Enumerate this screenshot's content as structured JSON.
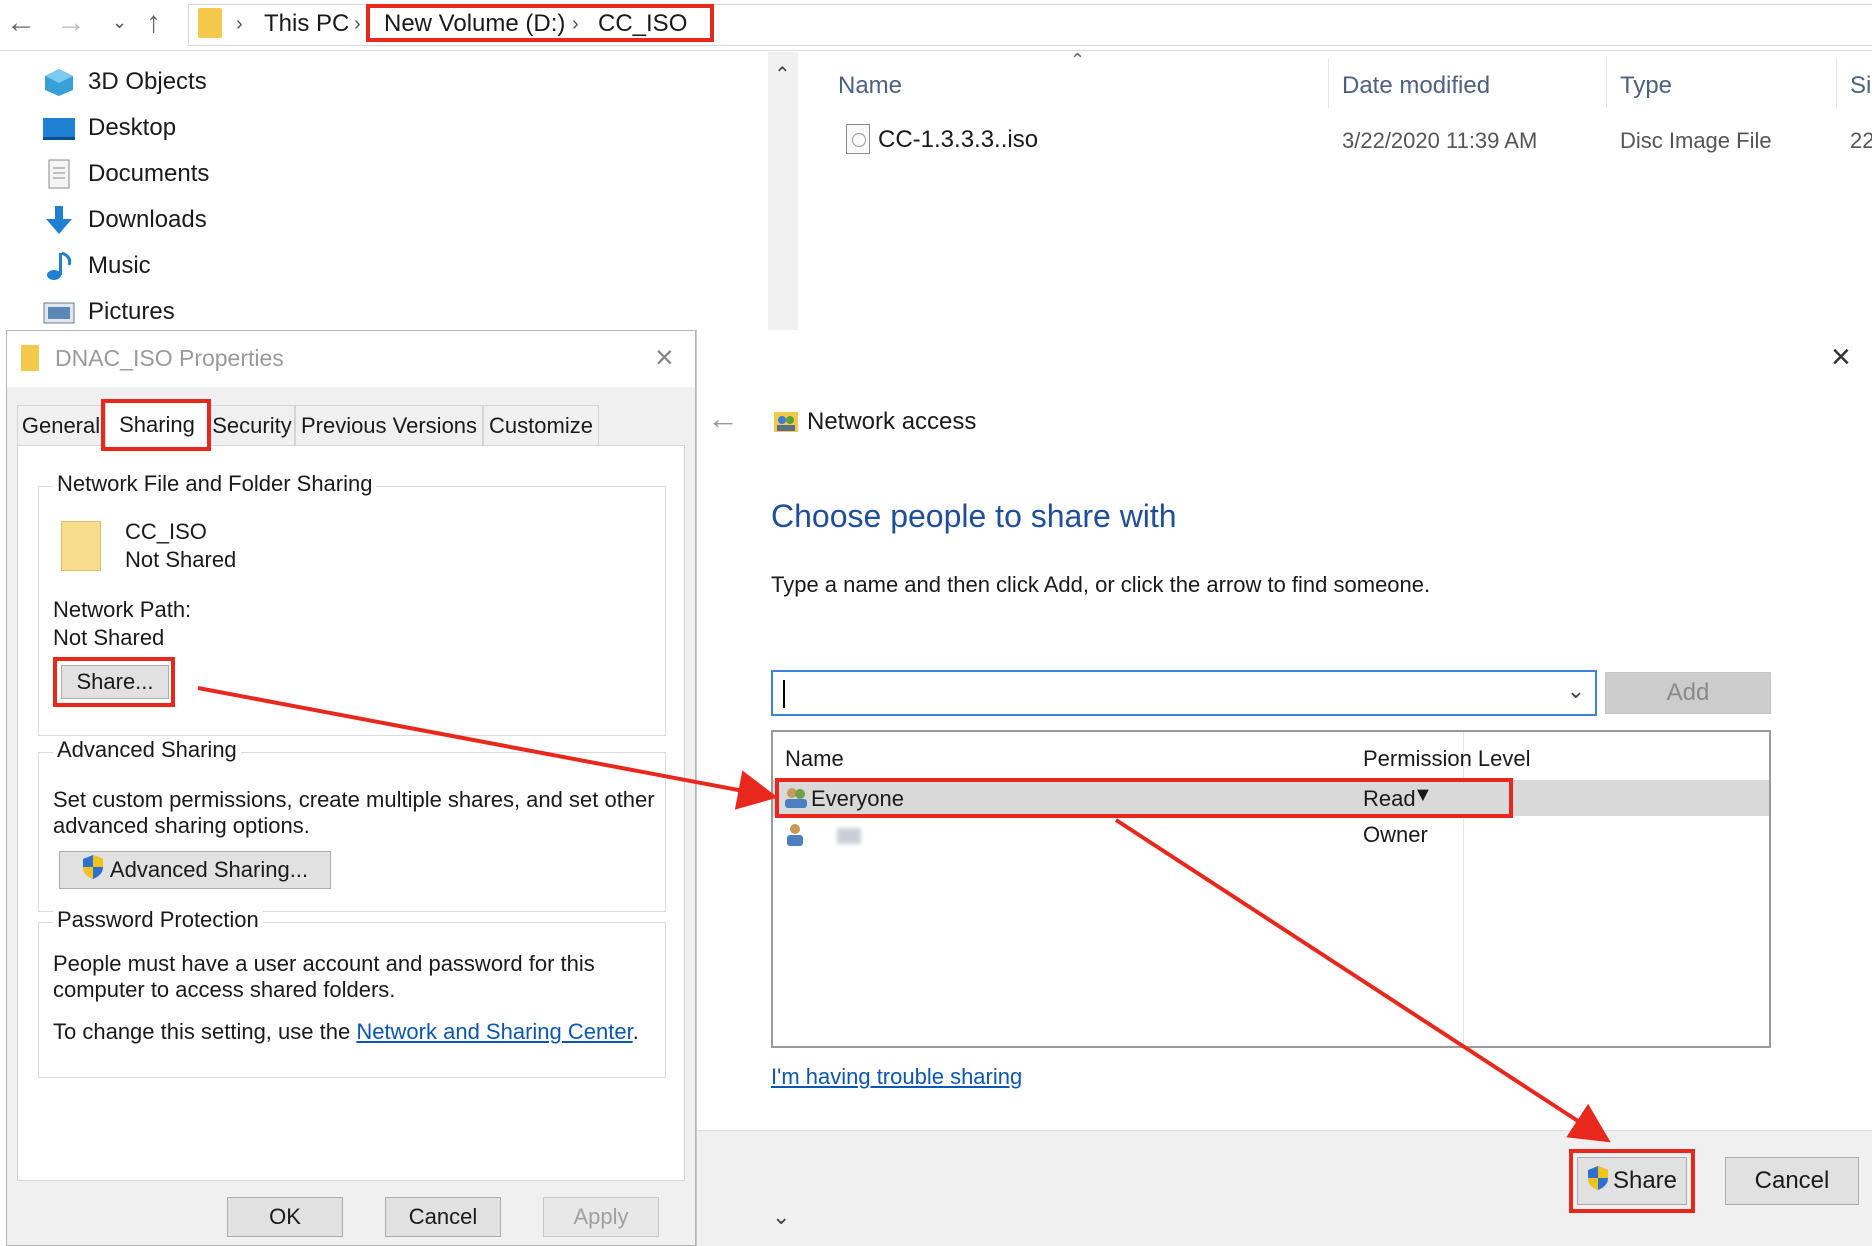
{
  "explorer": {
    "breadcrumb": [
      "This PC",
      "New Volume (D:)",
      "CC_ISO"
    ],
    "nav_items": [
      {
        "label": "3D Objects",
        "icon": "3d-objects-icon"
      },
      {
        "label": "Desktop",
        "icon": "desktop-icon"
      },
      {
        "label": "Documents",
        "icon": "documents-icon"
      },
      {
        "label": "Downloads",
        "icon": "downloads-icon"
      },
      {
        "label": "Music",
        "icon": "music-icon"
      },
      {
        "label": "Pictures",
        "icon": "pictures-icon"
      }
    ],
    "columns": {
      "name": "Name",
      "date": "Date modified",
      "type": "Type",
      "size": "Si"
    },
    "files": [
      {
        "name": "CC-1.3.3.3..iso",
        "date": "3/22/2020 11:39 AM",
        "type": "Disc Image File",
        "size": "22"
      }
    ]
  },
  "properties": {
    "title": "DNAC_ISO Properties",
    "tabs": [
      "General",
      "Sharing",
      "Security",
      "Previous Versions",
      "Customize"
    ],
    "active_tab": "Sharing",
    "network_sharing": {
      "group_label": "Network File and Folder Sharing",
      "folder_name": "CC_ISO",
      "folder_status": "Not Shared",
      "path_label": "Network Path:",
      "path_value": "Not Shared",
      "share_button": "Share..."
    },
    "advanced": {
      "group_label": "Advanced Sharing",
      "line1": "Set custom permissions, create multiple shares, and set other",
      "line2": "advanced sharing options.",
      "button": "Advanced Sharing..."
    },
    "password": {
      "group_label": "Password Protection",
      "line1": "People must have a user account and password for this",
      "line2": "computer to access shared folders.",
      "change_prefix": "To change this setting, use the ",
      "link": "Network and Sharing Center",
      "suffix": "."
    },
    "buttons": {
      "ok": "OK",
      "cancel": "Cancel",
      "apply": "Apply"
    }
  },
  "network_access": {
    "title": "Network access",
    "heading": "Choose people to share with",
    "instruction": "Type a name and then click Add, or click the arrow to find someone.",
    "input_value": "",
    "add_button": "Add",
    "list_headers": {
      "name": "Name",
      "permission": "Permission Level"
    },
    "rows": [
      {
        "name": "Everyone",
        "permission": "Read",
        "selected": true
      },
      {
        "name": "",
        "permission": "Owner",
        "selected": false
      }
    ],
    "trouble_link": "I'm having trouble sharing",
    "share_button": "Share",
    "cancel_button": "Cancel"
  },
  "colors": {
    "highlight_red": "#e8281d",
    "heading_blue": "#1f4e9c",
    "link_blue": "#0b57b5"
  }
}
